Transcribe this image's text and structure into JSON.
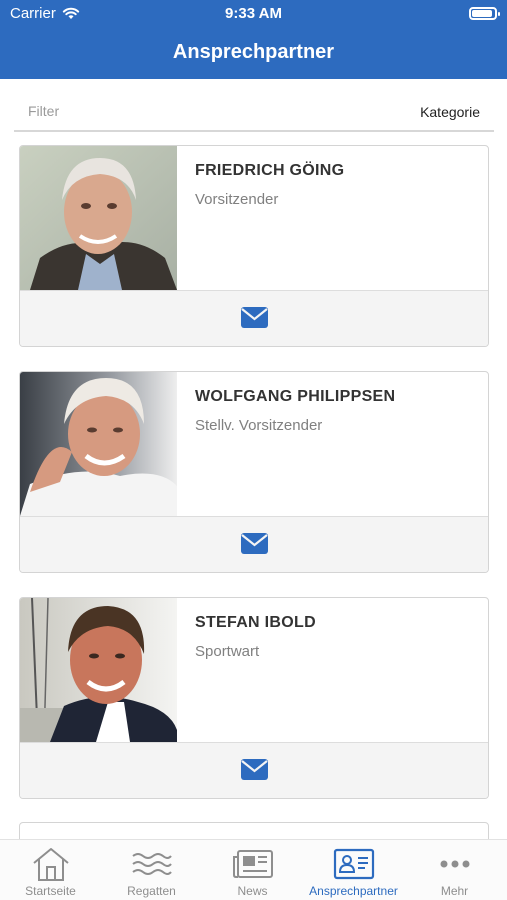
{
  "status_bar": {
    "carrier": "Carrier",
    "time": "9:33 AM"
  },
  "header": {
    "title": "Ansprechpartner"
  },
  "filter": {
    "placeholder": "Filter",
    "category_label": "Kategorie"
  },
  "contacts": [
    {
      "name": "FRIEDRICH GÖING",
      "role": "Vorsitzender"
    },
    {
      "name": "WOLFGANG PHILIPPSEN",
      "role": "Stellv. Vorsitzender"
    },
    {
      "name": "STEFAN IBOLD",
      "role": "Sportwart"
    }
  ],
  "tabs": [
    {
      "label": "Startseite",
      "icon": "home-icon"
    },
    {
      "label": "Regatten",
      "icon": "waves-icon"
    },
    {
      "label": "News",
      "icon": "newspaper-icon"
    },
    {
      "label": "Ansprechpartner",
      "icon": "contact-card-icon",
      "active": true
    },
    {
      "label": "Mehr",
      "icon": "more-dots-icon"
    }
  ],
  "colors": {
    "accent": "#2d6bbf",
    "inactive": "#8e8e8e"
  }
}
